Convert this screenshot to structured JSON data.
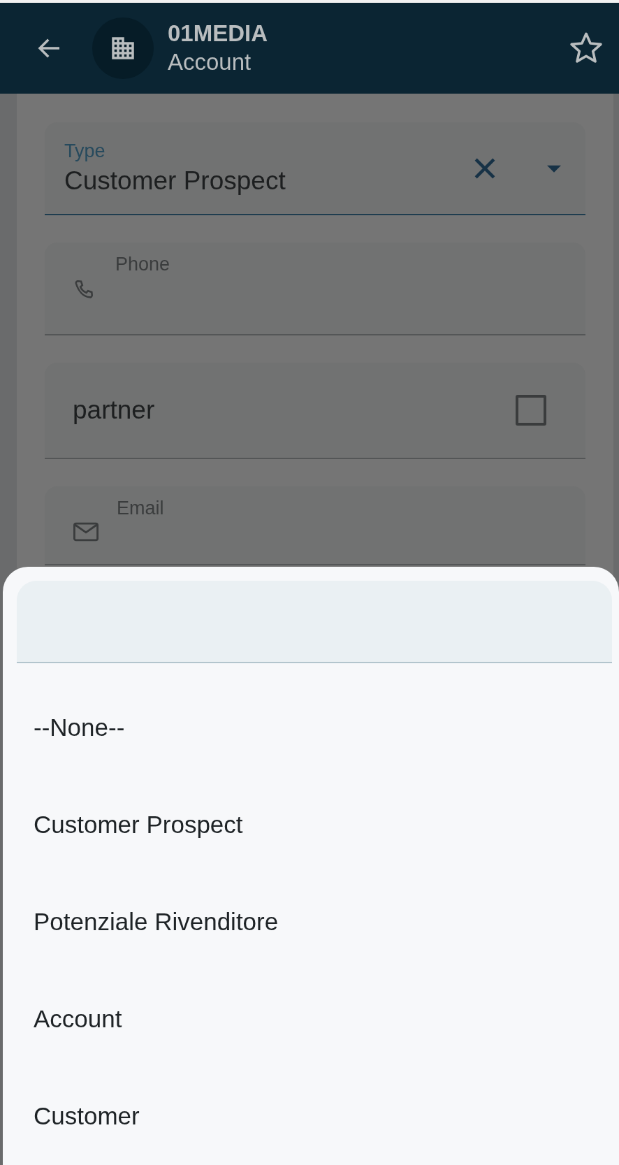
{
  "header": {
    "title": "01MEDIA",
    "subtitle": "Account",
    "favorite": false
  },
  "form": {
    "fields": [
      {
        "kind": "picklist",
        "label": "Type",
        "value": "Customer Prospect"
      },
      {
        "kind": "phone",
        "label": "Phone"
      },
      {
        "kind": "checkbox",
        "label": "partner",
        "checked": false
      },
      {
        "kind": "email",
        "label": "Email"
      }
    ]
  },
  "picker": {
    "options": [
      {
        "label": "--None--",
        "selected": false
      },
      {
        "label": "Customer Prospect",
        "selected": false
      },
      {
        "label": "Potenziale Rivenditore",
        "selected": false
      },
      {
        "label": "Account",
        "selected": false
      },
      {
        "label": "Customer",
        "selected": false
      }
    ]
  }
}
